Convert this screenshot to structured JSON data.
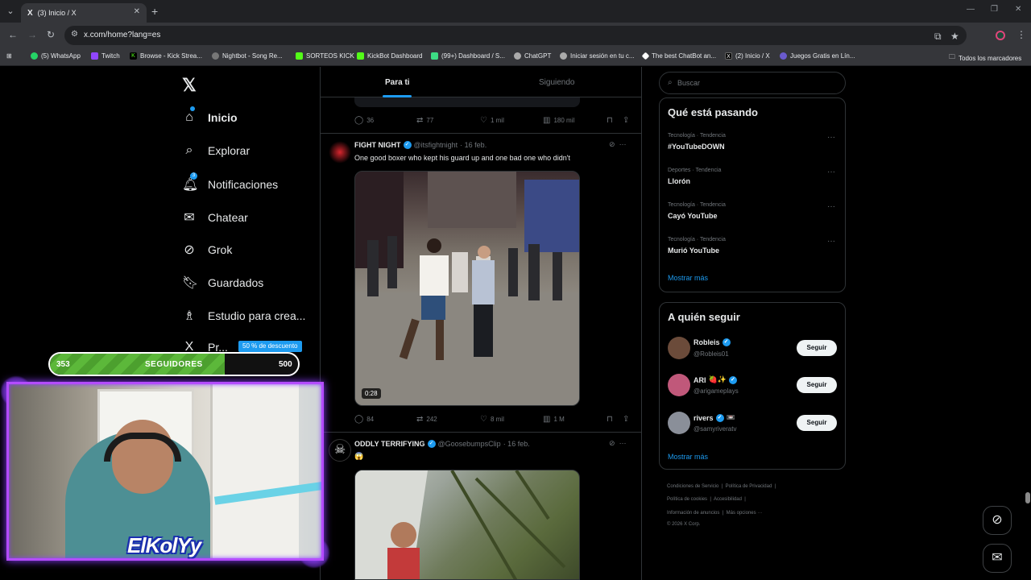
{
  "browser": {
    "tab": {
      "title": "(3) Inicio / X",
      "favicon": "X"
    },
    "url": "x.com/home?lang=es",
    "bookmarks": [
      {
        "label": "(5) WhatsApp",
        "color": "#25d366",
        "glyph": ""
      },
      {
        "label": "Twitch",
        "color": "#9146ff",
        "glyph": ""
      },
      {
        "label": "Browse - Kick Strea...",
        "color": "#53fc18",
        "glyph": "K"
      },
      {
        "label": "Nightbot - Song Re...",
        "color": "#777777",
        "glyph": ""
      },
      {
        "label": "SORTEOS KICK",
        "color": "#53fc18",
        "glyph": ""
      },
      {
        "label": "KickBot Dashboard",
        "color": "#53fc18",
        "glyph": ""
      },
      {
        "label": "(99+) Dashboard / S...",
        "color": "#3ddc84",
        "glyph": ""
      },
      {
        "label": "ChatGPT",
        "color": "#aaaaaa",
        "glyph": ""
      },
      {
        "label": "Iniciar sesión en tu c...",
        "color": "#aaaaaa",
        "glyph": ""
      },
      {
        "label": "The best ChatBot an...",
        "color": "#ffffff",
        "glyph": ""
      },
      {
        "label": "(2) Inicio / X",
        "color": "#000000",
        "glyph": "X"
      },
      {
        "label": "Juegos Gratis en Lín...",
        "color": "#6a5acd",
        "glyph": ""
      }
    ],
    "bookmarks_folder": "Todos los marcadores"
  },
  "sidebar": {
    "items": [
      {
        "label": "Inicio",
        "icon": "home-icon",
        "glyph": "⌂"
      },
      {
        "label": "Explorar",
        "icon": "search-icon",
        "glyph": "⌕"
      },
      {
        "label": "Notificaciones",
        "icon": "bell-icon",
        "glyph": "🔔︎"
      },
      {
        "label": "Chatear",
        "icon": "mail-icon",
        "glyph": "✉"
      },
      {
        "label": "Grok",
        "icon": "grok-icon",
        "glyph": "⊘"
      },
      {
        "label": "Guardados",
        "icon": "bookmark-icon",
        "glyph": "🔖︎"
      },
      {
        "label": "Estudio para crea...",
        "icon": "studio-icon",
        "glyph": "♗"
      },
      {
        "label": "Pr...",
        "icon": "x-premium-icon",
        "glyph": "X"
      }
    ],
    "notifications_count": "3",
    "promo": "50 % de descuento"
  },
  "feed": {
    "tabs": [
      "Para ti",
      "Siguiendo"
    ],
    "prev_post_stats": {
      "replies": "36",
      "reposts": "77",
      "likes": "1 mil",
      "views": "180 mil"
    },
    "posts": [
      {
        "name": "FIGHT NIGHT",
        "handle": "@itsfightnight",
        "date": "· 16 feb.",
        "text": "One good boxer who kept his guard up and one bad one who didn't",
        "duration": "0:28",
        "stats": {
          "replies": "84",
          "reposts": "242",
          "likes": "8 mil",
          "views": "1 M"
        }
      },
      {
        "name": "ODDLY TERRIFYING",
        "handle": "@GoosebumpsClip",
        "date": "· 16 feb.",
        "text": "😱"
      }
    ]
  },
  "right": {
    "search_placeholder": "Buscar",
    "trends_title": "Qué está pasando",
    "trends": [
      {
        "category": "Tecnología · Tendencia",
        "name": "#YouTubeDOWN"
      },
      {
        "category": "Deportes · Tendencia",
        "name": "Llorón"
      },
      {
        "category": "Tecnología · Tendencia",
        "name": "Cayó YouTube"
      },
      {
        "category": "Tecnología · Tendencia",
        "name": "Murió YouTube"
      }
    ],
    "show_more": "Mostrar más",
    "follow_title": "A quién seguir",
    "follow": [
      {
        "name": "Robleis",
        "handle": "@Robleis01",
        "extra": "",
        "color": "#6b4b3a"
      },
      {
        "name": "ARI",
        "handle": "@arigameplays",
        "extra": "🍓✨",
        "color": "#c0587a"
      },
      {
        "name": "rivers",
        "handle": "@samyriveratv",
        "extra": "📼",
        "color": "#8a8f99"
      }
    ],
    "follow_button": "Seguir",
    "footer": {
      "line1": [
        "Condiciones de Servicio",
        "Política de Privacidad"
      ],
      "line2": [
        "Política de cookies",
        "Accesibilidad"
      ],
      "line3": [
        "Información de anuncios",
        "Más opciones ···"
      ],
      "copyright": "© 2026 X Corp."
    }
  },
  "overlay": {
    "followers_current": "353",
    "followers_label": "SEGUIDORES",
    "followers_goal": "500",
    "followers_progress": 0.706,
    "streamer_logo": "ElKolYy"
  },
  "colors": {
    "accent": "#1d9bf0",
    "bar": "#4ca02e",
    "frame": "#b44cff"
  }
}
